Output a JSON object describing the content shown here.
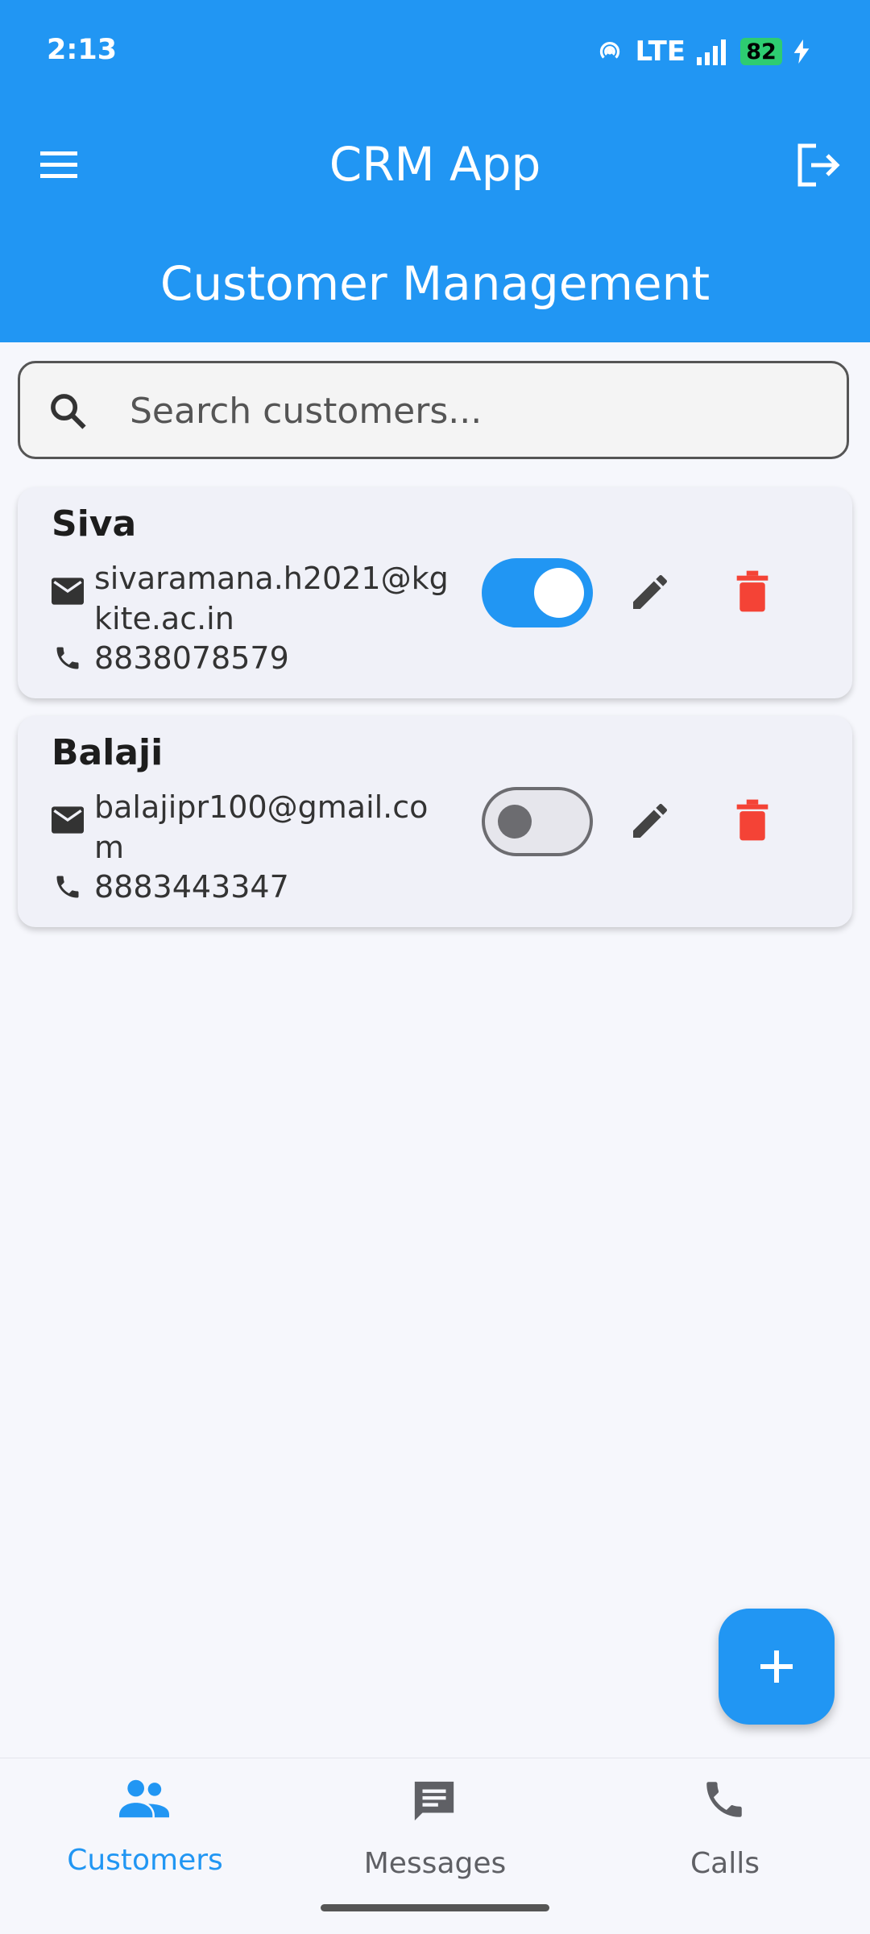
{
  "status_bar": {
    "time": "2:13",
    "network": "LTE",
    "battery": "82"
  },
  "app_bar": {
    "title": "CRM App",
    "subtitle": "Customer Management"
  },
  "search": {
    "placeholder": "Search customers..."
  },
  "customers": [
    {
      "name": "Siva",
      "email": "sivaramana.h2021@kgkite.ac.in",
      "phone": "8838078579",
      "active": true
    },
    {
      "name": "Balaji",
      "email": "balajipr100@gmail.com",
      "phone": "8883443347",
      "active": false
    }
  ],
  "bottom_nav": {
    "items": [
      {
        "label": "Customers",
        "icon": "people-icon",
        "selected": true
      },
      {
        "label": "Messages",
        "icon": "message-icon",
        "selected": false
      },
      {
        "label": "Calls",
        "icon": "phone-icon",
        "selected": false
      }
    ]
  },
  "colors": {
    "primary": "#2196f3",
    "delete": "#f44336",
    "background": "#f6f7fc",
    "card": "#f0f1f8",
    "nav_inactive": "#5f6065"
  }
}
